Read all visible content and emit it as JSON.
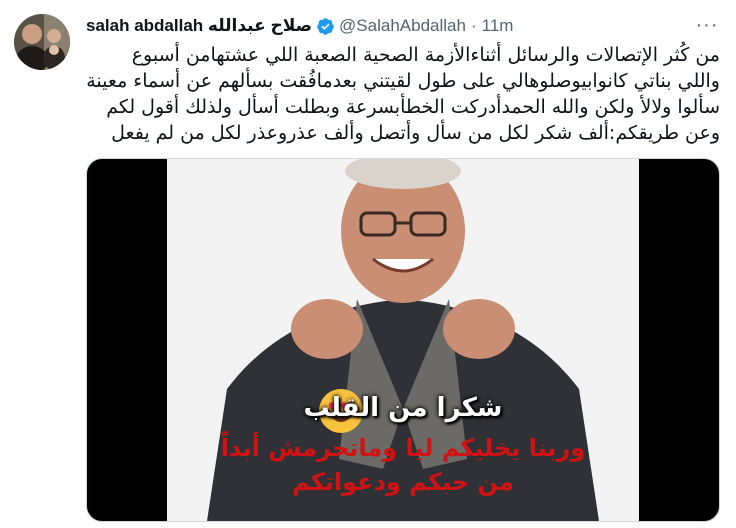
{
  "tweet": {
    "display_name": "salah abdallah صلاح عبدالله",
    "handle": "@SalahAbdallah",
    "separator": "·",
    "time": "11m",
    "more": "···",
    "text": "من كُثر الإتصالات والرسائل أثناءالأزمة الصحية الصعبة اللي عشتهامن أسبوع واللي بناتي كانوابيوصلوهالي على طول لقيتني بعدمافُقت بسألهم عن أسماء معينة سألوا ولالأ ولكن والله الحمدأدركت الخطأبسرعة وبطلت أسأل ولذلك أقول لكم وعن طريقكم:ألف شكر لكل من سأل وأتصل وألف عذروعذر لكل من لم يفعل"
  },
  "image": {
    "caption_line1": "شكرا من القلب",
    "caption_line2": "وربنا يخليكم ليا وماتحرمش أبداً",
    "caption_line3": "من حبكم ودعواتكم"
  },
  "colors": {
    "verified": "#1d9bf0",
    "caption_red": "#d01212",
    "muted": "#536471"
  }
}
